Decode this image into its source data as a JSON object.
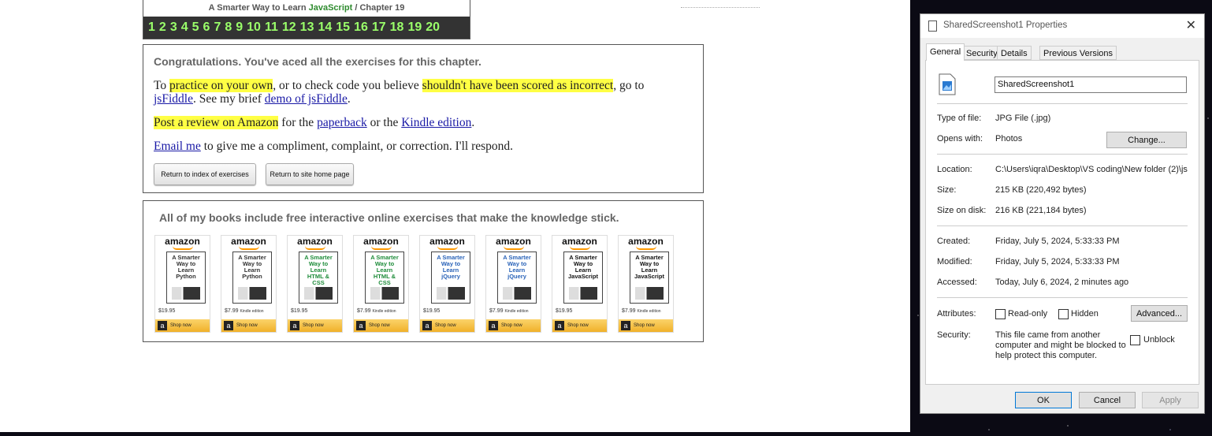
{
  "header": {
    "title_prefix": "A Smarter Way to Learn",
    "title_js": "JavaScript",
    "title_suffix": "/ Chapter 19",
    "chapters": [
      "1",
      "2",
      "3",
      "4",
      "5",
      "6",
      "7",
      "8",
      "9",
      "10",
      "11",
      "12",
      "13",
      "14",
      "15",
      "16",
      "17",
      "18",
      "19",
      "20"
    ]
  },
  "congrats": {
    "heading": "Congratulations. You've aced all the exercises for this chapter.",
    "p1_a": "To ",
    "p1_hl1": "practice on your own",
    "p1_b": ", or to check code you believe ",
    "p1_hl2": "shouldn't have been scored as incorrect",
    "p1_c": ", go to",
    "p1_link1": "jsFiddle",
    "p1_d": ". See my brief ",
    "p1_link2": "demo of jsFiddle",
    "p1_e": ".",
    "p2_hl": "Post a review on Amazon",
    "p2_a": " for the ",
    "p2_link1": "paperback",
    "p2_b": " or the ",
    "p2_link2": "Kindle edition",
    "p2_c": ".",
    "p3_link": "Email me",
    "p3_a": " to give me a compliment, complaint, or correction. I'll respond.",
    "btn_index": "Return to index of exercises",
    "btn_home": "Return to site home page"
  },
  "books": {
    "heading": "All of my books include free interactive online exercises that make the knowledge stick.",
    "items": [
      {
        "brand": "amazon",
        "title": "A Smarter Way to Learn Python",
        "price": "$19.95",
        "edition": "",
        "shop": "Shop now",
        "color": "#333333"
      },
      {
        "brand": "amazon",
        "title": "A Smarter Way to Learn Python",
        "price": "$7.99",
        "edition": "Kindle edition",
        "shop": "Shop now",
        "color": "#333333"
      },
      {
        "brand": "amazon",
        "title": "A Smarter Way to Learn HTML & CSS",
        "price": "$19.95",
        "edition": "",
        "shop": "Shop now",
        "color": "#1e8c3a"
      },
      {
        "brand": "amazon",
        "title": "A Smarter Way to Learn HTML & CSS",
        "price": "$7.99",
        "edition": "Kindle edition",
        "shop": "Shop now",
        "color": "#1e8c3a"
      },
      {
        "brand": "amazon",
        "title": "A Smarter Way to Learn jQuery",
        "price": "$19.95",
        "edition": "",
        "shop": "Shop now",
        "color": "#2a63b8"
      },
      {
        "brand": "amazon",
        "title": "A Smarter Way to Learn jQuery",
        "price": "$7.99",
        "edition": "Kindle edition",
        "shop": "Shop now",
        "color": "#2a63b8"
      },
      {
        "brand": "amazon",
        "title": "A Smarter Way to Learn JavaScript",
        "price": "$19.95",
        "edition": "",
        "shop": "Shop now",
        "color": "#111111"
      },
      {
        "brand": "amazon",
        "title": "A Smarter Way to Learn JavaScript",
        "price": "$7.99",
        "edition": "Kindle edition",
        "shop": "Shop now",
        "color": "#111111"
      }
    ]
  },
  "dialog": {
    "title": "SharedScreenshot1 Properties",
    "tabs": [
      "General",
      "Security",
      "Details",
      "Previous Versions"
    ],
    "filename": "SharedScreenshot1",
    "type_label": "Type of file:",
    "type_value": "JPG File (.jpg)",
    "opens_label": "Opens with:",
    "opens_value": "Photos",
    "change_btn": "Change...",
    "location_label": "Location:",
    "location_value": "C:\\Users\\iqra\\Desktop\\VS coding\\New folder (2)\\js",
    "size_label": "Size:",
    "size_value": "215 KB (220,492 bytes)",
    "sizeondisk_label": "Size on disk:",
    "sizeondisk_value": "216 KB (221,184 bytes)",
    "created_label": "Created:",
    "created_value": "Friday, July 5, 2024, 5:33:33 PM",
    "modified_label": "Modified:",
    "modified_value": "Friday, July 5, 2024, 5:33:33 PM",
    "accessed_label": "Accessed:",
    "accessed_value": "Today, July 6, 2024, 2 minutes ago",
    "attributes_label": "Attributes:",
    "readonly_label": "Read-only",
    "hidden_label": "Hidden",
    "advanced_btn": "Advanced...",
    "security_label": "Security:",
    "security_line1": "This file came from another",
    "security_line2": "computer and might be blocked to",
    "security_line3": "help protect this computer.",
    "unblock_label": "Unblock",
    "ok": "OK",
    "cancel": "Cancel",
    "apply": "Apply"
  }
}
